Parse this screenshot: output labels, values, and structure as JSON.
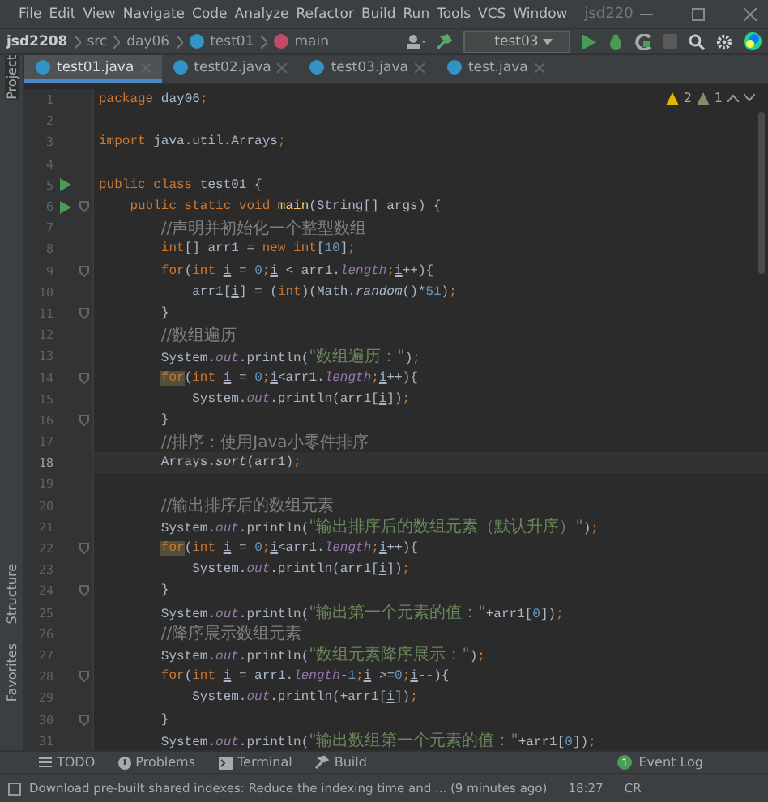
{
  "menu": {
    "items": [
      "File",
      "Edit",
      "View",
      "Navigate",
      "Code",
      "Analyze",
      "Refactor",
      "Build",
      "Run",
      "Tools",
      "VCS",
      "Window"
    ],
    "project_title": "jsd220"
  },
  "breadcrumbs": [
    {
      "kind": "project",
      "text": "jsd2208"
    },
    {
      "kind": "folder",
      "text": "src"
    },
    {
      "kind": "folder",
      "text": "day06"
    },
    {
      "kind": "class",
      "text": "test01"
    },
    {
      "kind": "method",
      "text": "main"
    }
  ],
  "run_config": "test03",
  "tabs": [
    {
      "label": "test01.java",
      "selected": true
    },
    {
      "label": "test02.java",
      "selected": false
    },
    {
      "label": "test03.java",
      "selected": false
    },
    {
      "label": "test.java",
      "selected": false
    }
  ],
  "side_tools_top": [
    "Project"
  ],
  "side_tools_bottom": [
    "Structure",
    "Favorites"
  ],
  "inspections": {
    "warnings": "2",
    "weak_warnings": "1"
  },
  "lines": [
    {
      "number": "1",
      "run": false,
      "fold": false,
      "current": false,
      "tokens": [
        {
          "kind": "kw",
          "text": "package"
        },
        {
          "kind": "plain",
          "text": " day06"
        },
        {
          "kind": "kw",
          "text": ";"
        }
      ]
    },
    {
      "number": "2",
      "run": false,
      "fold": false,
      "current": false
    },
    {
      "number": "3",
      "run": false,
      "fold": false,
      "current": false,
      "tokens": [
        {
          "kind": "kw",
          "text": "import"
        },
        {
          "kind": "plain",
          "text": " java.util.Arrays"
        },
        {
          "kind": "kw",
          "text": ";"
        }
      ]
    },
    {
      "number": "4",
      "run": false,
      "fold": false,
      "current": false
    },
    {
      "number": "5",
      "run": true,
      "fold": false,
      "current": false,
      "tokens": [
        {
          "kind": "kw",
          "text": "public class"
        },
        {
          "kind": "plain",
          "text": " test01 {"
        }
      ]
    },
    {
      "number": "6",
      "run": true,
      "fold": true,
      "current": false,
      "tokens": [
        {
          "kind": "kw",
          "text": "    public static void "
        },
        {
          "kind": "fn",
          "text": "main"
        },
        {
          "kind": "plain",
          "text": "(String[] args) {"
        }
      ]
    },
    {
      "number": "7",
      "run": false,
      "fold": false,
      "current": false,
      "tokens": [
        {
          "kind": "cmt",
          "text": "        //声明并初始化一个整型数组"
        }
      ]
    },
    {
      "number": "8",
      "run": false,
      "fold": false,
      "current": false,
      "tokens": [
        {
          "kind": "kw",
          "text": "        int"
        },
        {
          "kind": "plain",
          "text": "[] arr1 = "
        },
        {
          "kind": "kw",
          "text": "new int"
        },
        {
          "kind": "plain",
          "text": "["
        },
        {
          "kind": "num",
          "text": "10"
        },
        {
          "kind": "plain",
          "text": "]"
        },
        {
          "kind": "kw",
          "text": ";"
        }
      ]
    },
    {
      "number": "9",
      "run": false,
      "fold": true,
      "current": false,
      "tokens": [
        {
          "kind": "kw",
          "text": "        for"
        },
        {
          "kind": "plain",
          "text": "("
        },
        {
          "kind": "kw",
          "text": "int "
        },
        {
          "kind": "var",
          "text": "i"
        },
        {
          "kind": "plain",
          "text": " = "
        },
        {
          "kind": "num",
          "text": "0"
        },
        {
          "kind": "kw",
          "text": ";"
        },
        {
          "kind": "var",
          "text": "i"
        },
        {
          "kind": "plain",
          "text": " < arr1."
        },
        {
          "kind": "field",
          "text": "length"
        },
        {
          "kind": "kw",
          "text": ";"
        },
        {
          "kind": "var",
          "text": "i"
        },
        {
          "kind": "plain",
          "text": "++){"
        }
      ]
    },
    {
      "number": "10",
      "run": false,
      "fold": false,
      "current": false,
      "tokens": [
        {
          "kind": "plain",
          "text": "            arr1["
        },
        {
          "kind": "var",
          "text": "i"
        },
        {
          "kind": "plain",
          "text": "] = ("
        },
        {
          "kind": "kw",
          "text": "int"
        },
        {
          "kind": "plain",
          "text": ")(Math."
        },
        {
          "kind": "static",
          "text": "random"
        },
        {
          "kind": "plain",
          "text": "()*"
        },
        {
          "kind": "num",
          "text": "51"
        },
        {
          "kind": "plain",
          "text": ")"
        },
        {
          "kind": "kw",
          "text": ";"
        }
      ]
    },
    {
      "number": "11",
      "run": false,
      "fold": true,
      "current": false,
      "tokens": [
        {
          "kind": "plain",
          "text": "        }"
        }
      ]
    },
    {
      "number": "12",
      "run": false,
      "fold": false,
      "current": false,
      "tokens": [
        {
          "kind": "cmt",
          "text": "        //数组遍历"
        }
      ]
    },
    {
      "number": "13",
      "run": false,
      "fold": false,
      "current": false,
      "tokens": [
        {
          "kind": "plain",
          "text": "        System."
        },
        {
          "kind": "field",
          "text": "out"
        },
        {
          "kind": "plain",
          "text": ".println("
        },
        {
          "kind": "str",
          "text": "\"数组遍历：\""
        },
        {
          "kind": "plain",
          "text": ")"
        },
        {
          "kind": "kw",
          "text": ";"
        }
      ]
    },
    {
      "number": "14",
      "run": false,
      "fold": true,
      "current": false,
      "tokens": [
        {
          "kind": "kwwarn",
          "text": "        for"
        },
        {
          "kind": "plain",
          "text": "("
        },
        {
          "kind": "kw",
          "text": "int "
        },
        {
          "kind": "var",
          "text": "i"
        },
        {
          "kind": "plain",
          "text": " = "
        },
        {
          "kind": "num",
          "text": "0"
        },
        {
          "kind": "kw",
          "text": ";"
        },
        {
          "kind": "var",
          "text": "i"
        },
        {
          "kind": "plain",
          "text": "<arr1."
        },
        {
          "kind": "field",
          "text": "length"
        },
        {
          "kind": "kw",
          "text": ";"
        },
        {
          "kind": "var",
          "text": "i"
        },
        {
          "kind": "plain",
          "text": "++){"
        }
      ]
    },
    {
      "number": "15",
      "run": false,
      "fold": false,
      "current": false,
      "tokens": [
        {
          "kind": "plain",
          "text": "            System."
        },
        {
          "kind": "field",
          "text": "out"
        },
        {
          "kind": "plain",
          "text": ".println(arr1["
        },
        {
          "kind": "var",
          "text": "i"
        },
        {
          "kind": "plain",
          "text": "])"
        },
        {
          "kind": "kw",
          "text": ";"
        }
      ]
    },
    {
      "number": "16",
      "run": false,
      "fold": true,
      "current": false,
      "tokens": [
        {
          "kind": "plain",
          "text": "        }"
        }
      ]
    },
    {
      "number": "17",
      "run": false,
      "fold": false,
      "current": false,
      "tokens": [
        {
          "kind": "cmt",
          "text": "        //排序：使用Java小零件排序"
        }
      ]
    },
    {
      "number": "18",
      "run": false,
      "fold": false,
      "current": true,
      "tokens": [
        {
          "kind": "plain",
          "text": "        Arrays."
        },
        {
          "kind": "static",
          "text": "sort"
        },
        {
          "kind": "plain",
          "text": "(arr1)"
        },
        {
          "kind": "kw",
          "text": ";"
        }
      ]
    },
    {
      "number": "19",
      "run": false,
      "fold": false,
      "current": false
    },
    {
      "number": "20",
      "run": false,
      "fold": false,
      "current": false,
      "tokens": [
        {
          "kind": "cmt",
          "text": "        //输出排序后的数组元素"
        }
      ]
    },
    {
      "number": "21",
      "run": false,
      "fold": false,
      "current": false,
      "tokens": [
        {
          "kind": "plain",
          "text": "        System."
        },
        {
          "kind": "field",
          "text": "out"
        },
        {
          "kind": "plain",
          "text": ".println("
        },
        {
          "kind": "str",
          "text": "\"输出排序后的数组元素（默认升序）\""
        },
        {
          "kind": "plain",
          "text": ")"
        },
        {
          "kind": "kw",
          "text": ";"
        }
      ]
    },
    {
      "number": "22",
      "run": false,
      "fold": true,
      "current": false,
      "tokens": [
        {
          "kind": "kwwarn",
          "text": "        for"
        },
        {
          "kind": "plain",
          "text": "("
        },
        {
          "kind": "kw",
          "text": "int "
        },
        {
          "kind": "var",
          "text": "i"
        },
        {
          "kind": "plain",
          "text": " = "
        },
        {
          "kind": "num",
          "text": "0"
        },
        {
          "kind": "kw",
          "text": ";"
        },
        {
          "kind": "var",
          "text": "i"
        },
        {
          "kind": "plain",
          "text": "<arr1."
        },
        {
          "kind": "field",
          "text": "length"
        },
        {
          "kind": "kw",
          "text": ";"
        },
        {
          "kind": "var",
          "text": "i"
        },
        {
          "kind": "plain",
          "text": "++){"
        }
      ]
    },
    {
      "number": "23",
      "run": false,
      "fold": false,
      "current": false,
      "tokens": [
        {
          "kind": "plain",
          "text": "            System."
        },
        {
          "kind": "field",
          "text": "out"
        },
        {
          "kind": "plain",
          "text": ".println(arr1["
        },
        {
          "kind": "var",
          "text": "i"
        },
        {
          "kind": "plain",
          "text": "])"
        },
        {
          "kind": "kw",
          "text": ";"
        }
      ]
    },
    {
      "number": "24",
      "run": false,
      "fold": true,
      "current": false,
      "tokens": [
        {
          "kind": "plain",
          "text": "        }"
        }
      ]
    },
    {
      "number": "25",
      "run": false,
      "fold": false,
      "current": false,
      "tokens": [
        {
          "kind": "plain",
          "text": "        System."
        },
        {
          "kind": "field",
          "text": "out"
        },
        {
          "kind": "plain",
          "text": ".println("
        },
        {
          "kind": "str",
          "text": "\"输出第一个元素的值：\""
        },
        {
          "kind": "plain",
          "text": "+arr1["
        },
        {
          "kind": "num",
          "text": "0"
        },
        {
          "kind": "plain",
          "text": "])"
        },
        {
          "kind": "kw",
          "text": ";"
        }
      ]
    },
    {
      "number": "26",
      "run": false,
      "fold": false,
      "current": false,
      "tokens": [
        {
          "kind": "cmt",
          "text": "        //降序展示数组元素"
        }
      ]
    },
    {
      "number": "27",
      "run": false,
      "fold": false,
      "current": false,
      "tokens": [
        {
          "kind": "plain",
          "text": "        System."
        },
        {
          "kind": "field",
          "text": "out"
        },
        {
          "kind": "plain",
          "text": ".println("
        },
        {
          "kind": "str",
          "text": "\"数组元素降序展示：\""
        },
        {
          "kind": "plain",
          "text": ")"
        },
        {
          "kind": "kw",
          "text": ";"
        }
      ]
    },
    {
      "number": "28",
      "run": false,
      "fold": true,
      "current": false,
      "tokens": [
        {
          "kind": "kw",
          "text": "        for"
        },
        {
          "kind": "plain",
          "text": "("
        },
        {
          "kind": "kw",
          "text": "int "
        },
        {
          "kind": "var",
          "text": "i"
        },
        {
          "kind": "plain",
          "text": " = arr1."
        },
        {
          "kind": "field",
          "text": "length"
        },
        {
          "kind": "plain",
          "text": "-"
        },
        {
          "kind": "num",
          "text": "1"
        },
        {
          "kind": "kw",
          "text": ";"
        },
        {
          "kind": "var",
          "text": "i"
        },
        {
          "kind": "plain",
          "text": " >="
        },
        {
          "kind": "num",
          "text": "0"
        },
        {
          "kind": "kw",
          "text": ";"
        },
        {
          "kind": "var",
          "text": "i"
        },
        {
          "kind": "plain",
          "text": "--){"
        }
      ]
    },
    {
      "number": "29",
      "run": false,
      "fold": false,
      "current": false,
      "tokens": [
        {
          "kind": "plain",
          "text": "            System."
        },
        {
          "kind": "field",
          "text": "out"
        },
        {
          "kind": "plain",
          "text": ".println(+arr1["
        },
        {
          "kind": "var",
          "text": "i"
        },
        {
          "kind": "plain",
          "text": "])"
        },
        {
          "kind": "kw",
          "text": ";"
        }
      ]
    },
    {
      "number": "30",
      "run": false,
      "fold": true,
      "current": false,
      "tokens": [
        {
          "kind": "plain",
          "text": "        }"
        }
      ]
    },
    {
      "number": "31",
      "run": false,
      "fold": false,
      "current": false,
      "tokens": [
        {
          "kind": "plain",
          "text": "        System."
        },
        {
          "kind": "field",
          "text": "out"
        },
        {
          "kind": "plain",
          "text": ".println("
        },
        {
          "kind": "str",
          "text": "\"输出数组第一个元素的值：\""
        },
        {
          "kind": "plain",
          "text": "+arr1["
        },
        {
          "kind": "num",
          "text": "0"
        },
        {
          "kind": "plain",
          "text": "])"
        },
        {
          "kind": "kw",
          "text": ";"
        }
      ]
    }
  ],
  "tool_windows": [
    {
      "kind": "todo",
      "label": "TODO"
    },
    {
      "kind": "problems",
      "label": "Problems"
    },
    {
      "kind": "terminal",
      "label": "Terminal"
    },
    {
      "kind": "build",
      "label": "Build"
    }
  ],
  "event_log": {
    "label": "Event Log",
    "count": "1"
  },
  "status_bar": {
    "message": "Download pre-built shared indexes: Reduce the indexing time and ... (9 minutes ago)",
    "position": "18:27",
    "line_separator": "CR"
  }
}
